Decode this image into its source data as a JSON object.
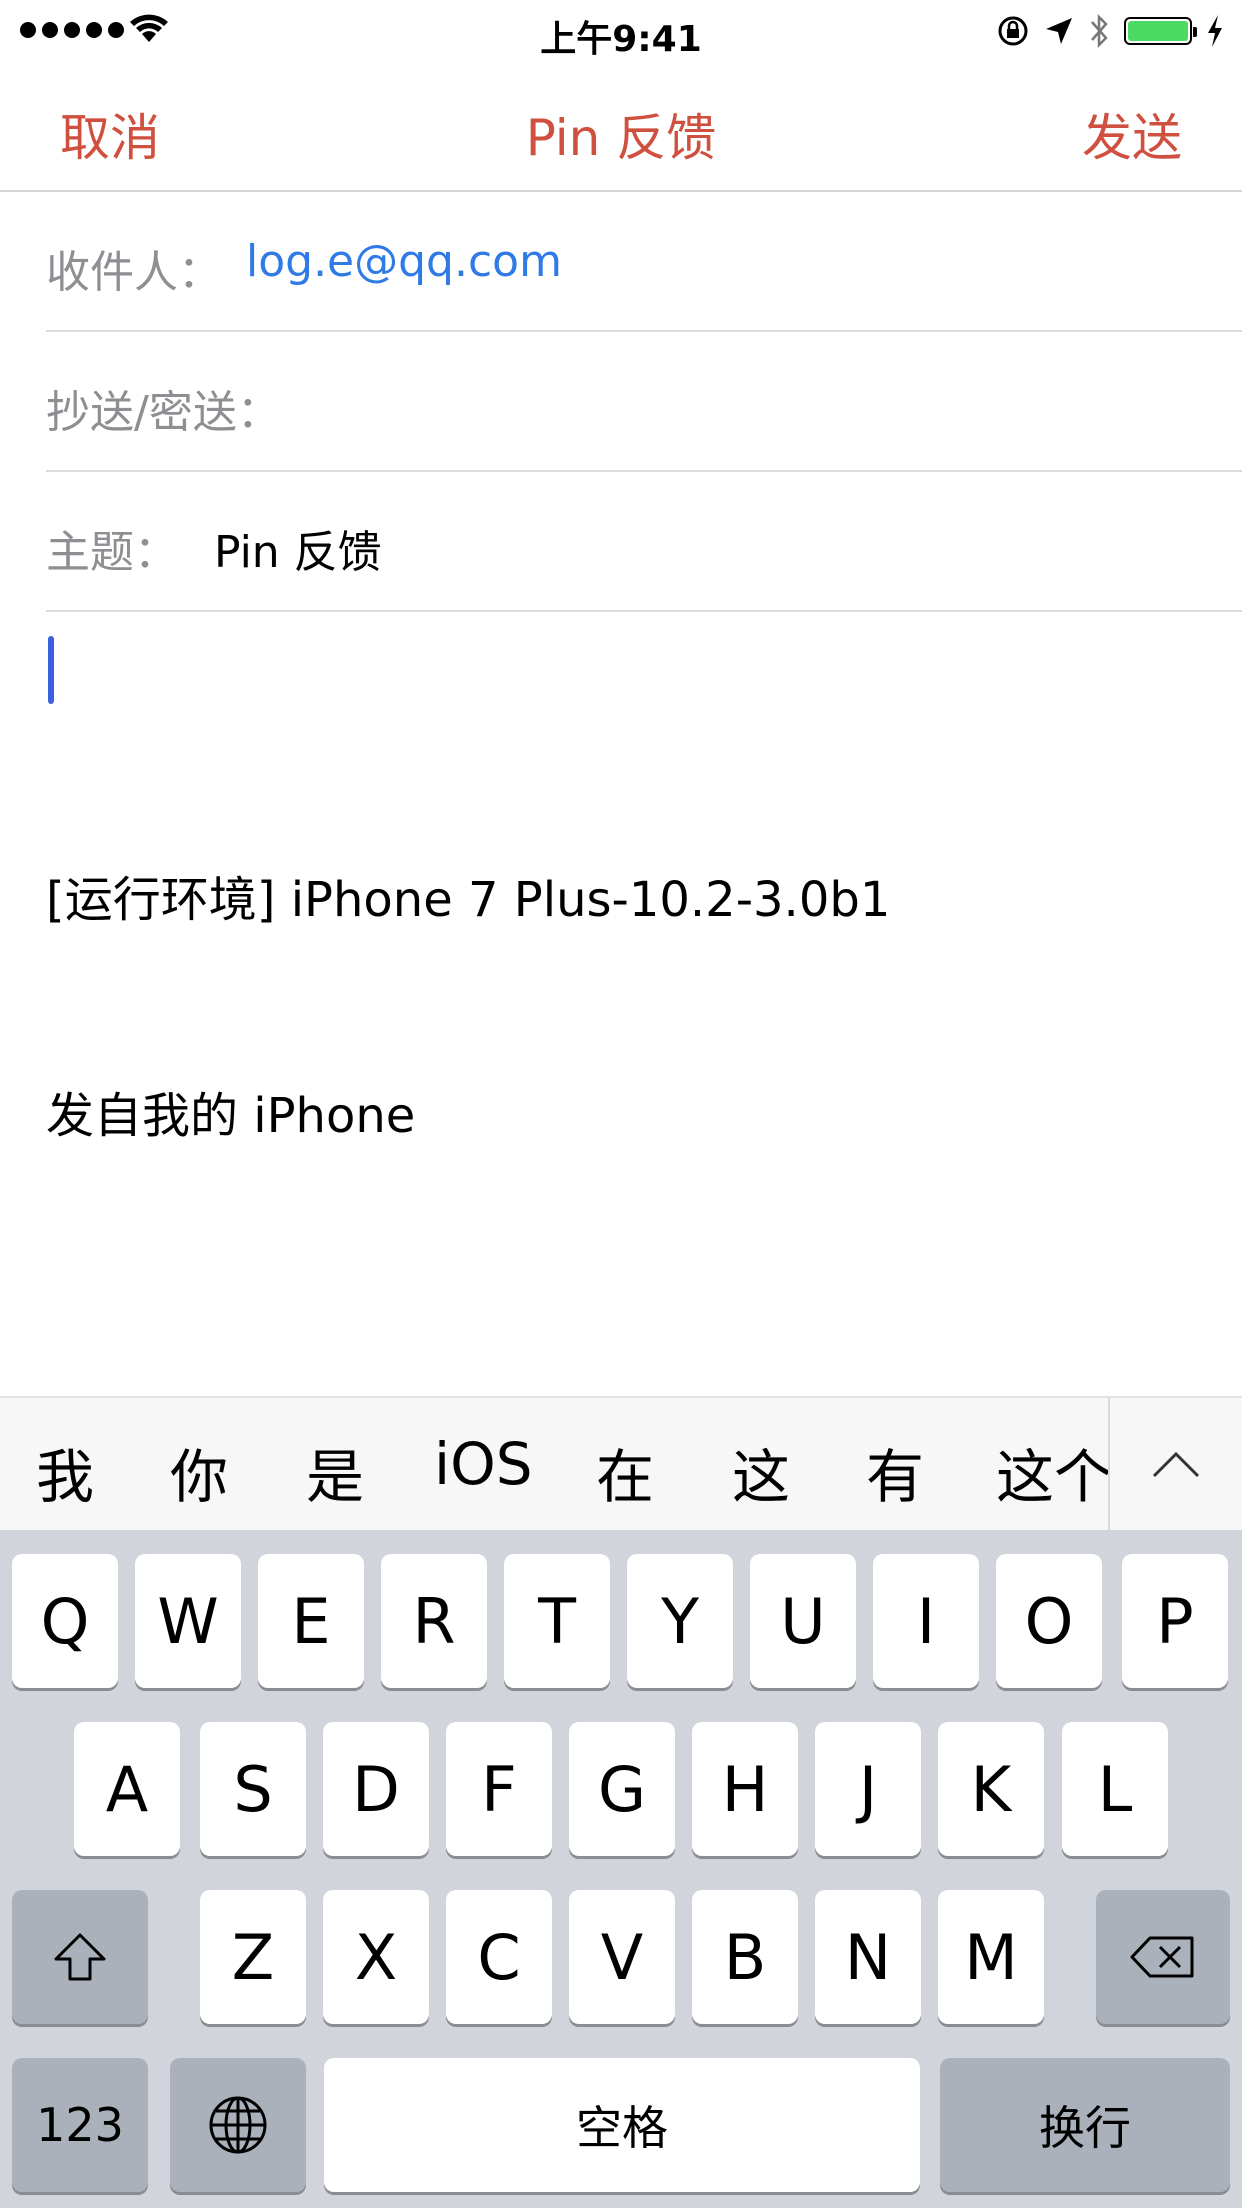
{
  "status": {
    "time": "上午9:41"
  },
  "nav": {
    "cancel": "取消",
    "title": "Pin 反馈",
    "send": "发送",
    "accent_color": "#d0503f"
  },
  "fields": {
    "to_label": "收件人：",
    "to_value": "log.e@qq.com",
    "cc_label": "抄送/密送：",
    "subject_label": "主题：",
    "subject_value": "Pin 反馈"
  },
  "body": {
    "line1": "[运行环境] iPhone 7 Plus-10.2-3.0b1",
    "line2": "发自我的 iPhone"
  },
  "suggestions": [
    "我",
    "你",
    "是",
    "iOS",
    "在",
    "这",
    "有",
    "这个"
  ],
  "keyboard": {
    "row1": [
      "Q",
      "W",
      "E",
      "R",
      "T",
      "Y",
      "U",
      "I",
      "O",
      "P"
    ],
    "row2": [
      "A",
      "S",
      "D",
      "F",
      "G",
      "H",
      "J",
      "K",
      "L"
    ],
    "row3": [
      "Z",
      "X",
      "C",
      "V",
      "B",
      "N",
      "M"
    ],
    "numbers": "123",
    "space": "空格",
    "return": "换行"
  }
}
